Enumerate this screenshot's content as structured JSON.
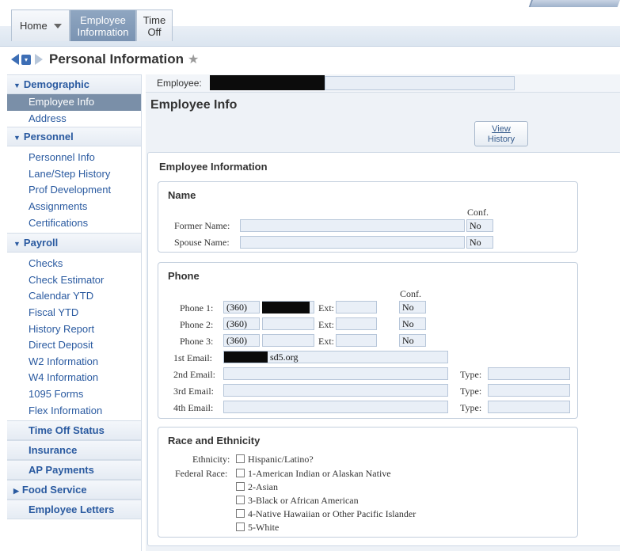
{
  "tabs": {
    "home": "Home",
    "employee_info_line1": "Employee",
    "employee_info_line2": "Information",
    "time_off_line1": "Time",
    "time_off_line2": "Off"
  },
  "page_title": "Personal Information",
  "sidebar": {
    "demographic": "Demographic",
    "employee_info": "Employee Info",
    "address": "Address",
    "personnel": "Personnel",
    "personnel_info": "Personnel Info",
    "lane_step_history": "Lane/Step History",
    "prof_development": "Prof Development",
    "assignments": "Assignments",
    "certifications": "Certifications",
    "payroll": "Payroll",
    "checks": "Checks",
    "check_estimator": "Check Estimator",
    "calendar_ytd": "Calendar YTD",
    "fiscal_ytd": "Fiscal YTD",
    "history_report": "History Report",
    "direct_deposit": "Direct Deposit",
    "w2_information": "W2 Information",
    "w4_information": "W4 Information",
    "forms_1095": "1095 Forms",
    "flex_information": "Flex Information",
    "time_off_status": "Time Off Status",
    "insurance": "Insurance",
    "ap_payments": "AP Payments",
    "food_service": "Food Service",
    "employee_letters": "Employee Letters"
  },
  "main": {
    "employee_label": "Employee:",
    "section_title": "Employee Info",
    "view_history_line1": "View",
    "view_history_line2": "History",
    "card_title": "Employee Information",
    "name_box": {
      "title": "Name",
      "conf_header": "Conf.",
      "former_name_label": "Former Name:",
      "former_name_conf": "No",
      "spouse_name_label": "Spouse Name:",
      "spouse_name_conf": "No"
    },
    "phone_box": {
      "title": "Phone",
      "conf_header": "Conf.",
      "phone1_label": "Phone 1:",
      "phone1_area": "(360)",
      "phone1_ext_label": "Ext:",
      "phone1_conf": "No",
      "phone2_label": "Phone 2:",
      "phone2_area": "(360)",
      "phone2_ext_label": "Ext:",
      "phone2_conf": "No",
      "phone3_label": "Phone 3:",
      "phone3_area": "(360)",
      "phone3_ext_label": "Ext:",
      "phone3_conf": "No",
      "email1_label": "1st Email:",
      "email1_value": "sd5.org",
      "email2_label": "2nd Email:",
      "email3_label": "3rd Email:",
      "email4_label": "4th Email:",
      "type_label": "Type:"
    },
    "race_box": {
      "title": "Race and Ethnicity",
      "ethnicity_label": "Ethnicity:",
      "hispanic": "Hispanic/Latino?",
      "federal_race_label": "Federal Race:",
      "race1": "1-American Indian or Alaskan Native",
      "race2": "2-Asian",
      "race3": "3-Black or African American",
      "race4": "4-Native Hawaiian or Other Pacific Islander",
      "race5": "5-White"
    }
  }
}
